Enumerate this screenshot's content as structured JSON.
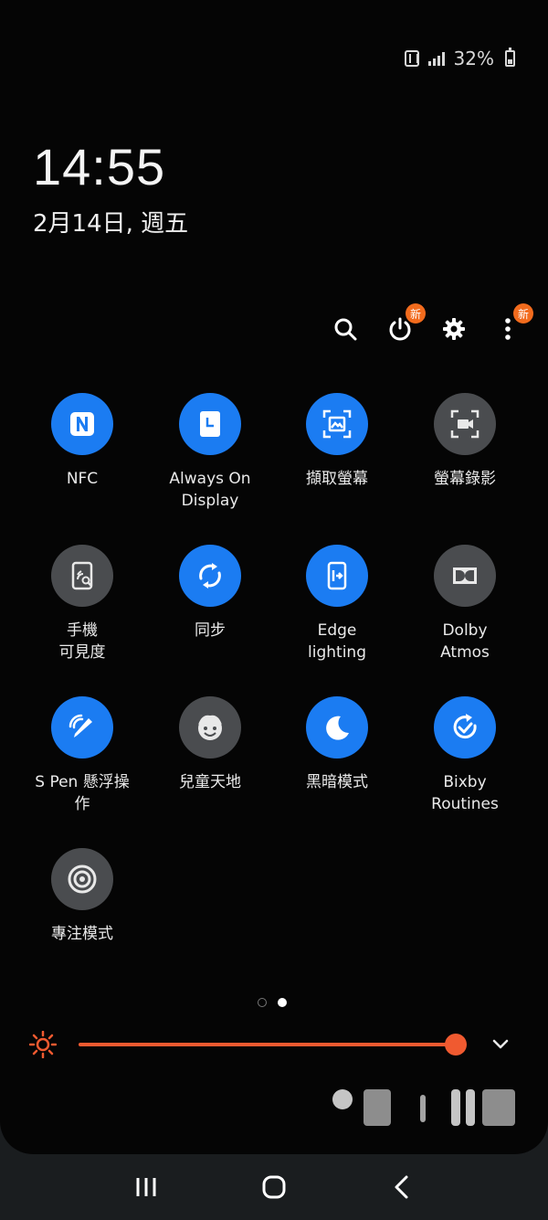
{
  "status": {
    "battery_text": "32%",
    "icons": [
      "nfc-icon",
      "signal-icon",
      "battery-icon"
    ]
  },
  "lockscreen": {
    "time": "14:55",
    "date": "2月14日, 週五"
  },
  "actions": {
    "search": "search-icon",
    "power": {
      "icon": "power-icon",
      "badge": "新"
    },
    "settings": "gear-icon",
    "more": {
      "icon": "more-vertical-icon",
      "badge": "新"
    }
  },
  "tiles": [
    {
      "label": "NFC",
      "state": "on",
      "icon": "nfc-icon"
    },
    {
      "label": "Always On\nDisplay",
      "state": "on",
      "icon": "always-on-display-icon"
    },
    {
      "label": "擷取螢幕",
      "state": "on",
      "icon": "screenshot-icon"
    },
    {
      "label": "螢幕錄影",
      "state": "off",
      "icon": "screen-record-icon"
    },
    {
      "label": "手機\n可見度",
      "state": "off",
      "icon": "phone-visibility-icon"
    },
    {
      "label": "同步",
      "state": "on",
      "icon": "sync-icon"
    },
    {
      "label": "Edge\nlighting",
      "state": "on",
      "icon": "edge-lighting-icon"
    },
    {
      "label": "Dolby\nAtmos",
      "state": "off",
      "icon": "dolby-icon"
    },
    {
      "label": "S Pen 懸浮操\n作",
      "state": "on",
      "icon": "s-pen-icon"
    },
    {
      "label": "兒童天地",
      "state": "off",
      "icon": "kids-icon"
    },
    {
      "label": "黑暗模式",
      "state": "on",
      "icon": "moon-icon"
    },
    {
      "label": "Bixby\nRoutines",
      "state": "on",
      "icon": "bixby-routines-icon"
    },
    {
      "label": "專注模式",
      "state": "off",
      "icon": "focus-mode-icon"
    }
  ],
  "pager": {
    "pages": 2,
    "current": 2
  },
  "brightness": {
    "level": 0.96,
    "accent": "#f05a30"
  },
  "colors": {
    "active": "#1b7cf2",
    "inactive": "#4a4c4f",
    "badge": "#f26b1d"
  },
  "navbar": {
    "recents": "recents-icon",
    "home": "home-icon",
    "back": "back-icon"
  }
}
